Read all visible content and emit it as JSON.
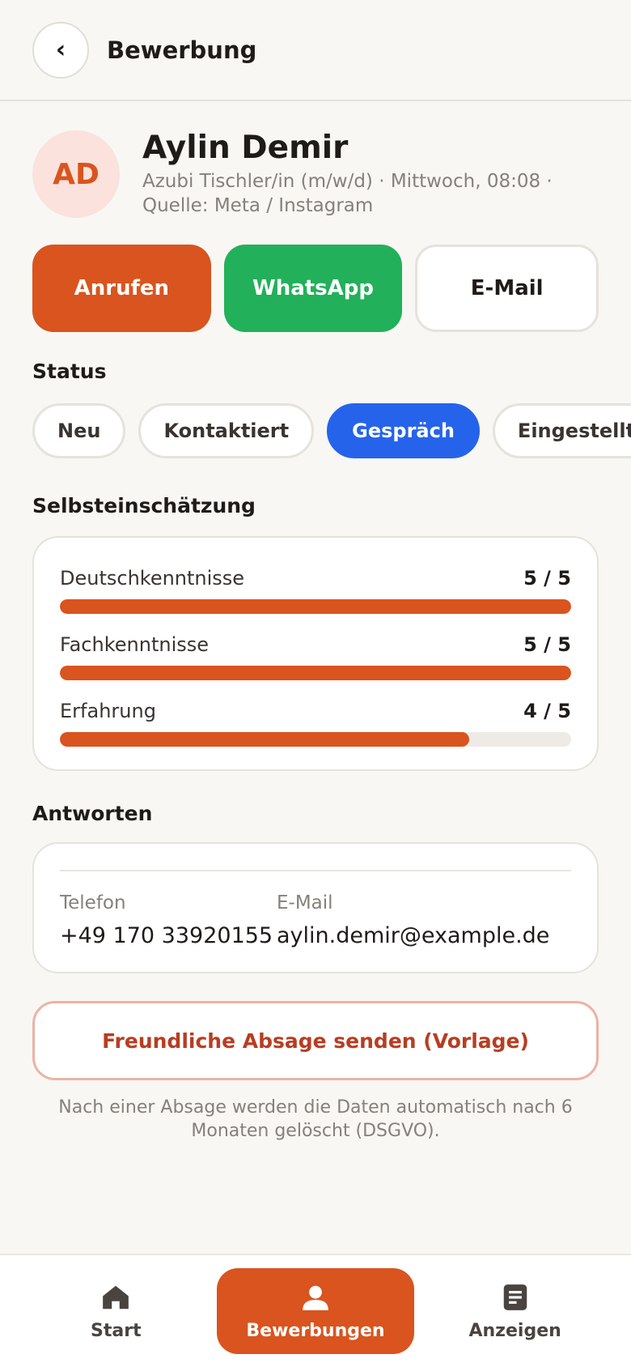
{
  "header": {
    "back_icon": "chevron-left-icon",
    "title": "Bewerbung"
  },
  "profile": {
    "initials": "AD",
    "name": "Aylin Demir",
    "subtitle": "Azubi Tischler/in (m/w/d) · Mittwoch, 08:08 · Quelle: Meta / Instagram"
  },
  "actions": {
    "call": "Anrufen",
    "whatsapp": "WhatsApp",
    "email": "E-Mail"
  },
  "status": {
    "label": "Status",
    "chips": [
      "Neu",
      "Kontaktiert",
      "Gespräch",
      "Eingestellt"
    ],
    "selected": "Gespräch"
  },
  "self_assessment": {
    "label": "Selbsteinschätzung",
    "items": [
      {
        "label": "Deutschkenntnisse",
        "value": "5 / 5",
        "score": 5,
        "max": 5
      },
      {
        "label": "Fachkenntnisse",
        "value": "5 / 5",
        "score": 5,
        "max": 5
      },
      {
        "label": "Erfahrung",
        "value": "4 / 5",
        "score": 4,
        "max": 5
      }
    ]
  },
  "answers": {
    "label": "Antworten",
    "phone_label": "Telefon",
    "phone_value": "+49 170 33920155",
    "email_label": "E-Mail",
    "email_value": "aylin.demir@example.de"
  },
  "reject_button": "Freundliche Absage senden (Vorlage)",
  "note": "Nach einer Absage werden die Daten automatisch nach 6 Monaten gelöscht (DSGVO).",
  "nav": [
    {
      "label": "Start",
      "icon": "home-icon",
      "active": false
    },
    {
      "label": "Bewerbungen",
      "icon": "person-icon",
      "active": true
    },
    {
      "label": "Anzeigen",
      "icon": "document-icon",
      "active": false
    }
  ],
  "colors": {
    "accent": "#d9541e",
    "whatsapp": "#22b05a",
    "status_active": "#2563eb"
  }
}
